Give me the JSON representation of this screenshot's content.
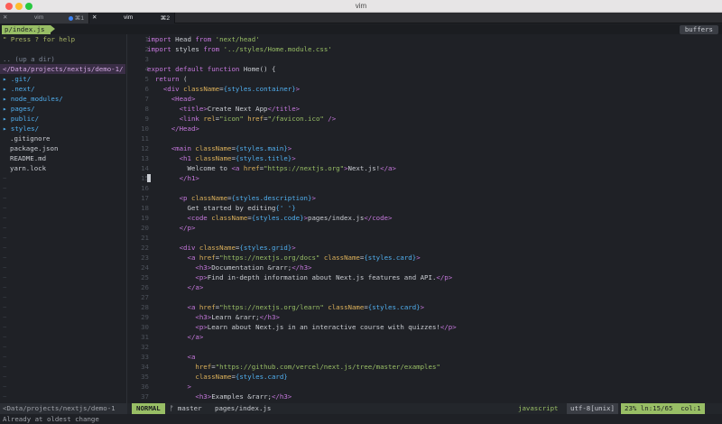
{
  "window": {
    "title": "vim"
  },
  "tabs": [
    {
      "name": "vim",
      "shortcut": "⌘1",
      "close": "✕"
    },
    {
      "name": "vim",
      "shortcut": "⌘2",
      "close": "✕"
    }
  ],
  "tabline": {
    "path": "p/index.js",
    "buffers_label": "buffers"
  },
  "sidebar": {
    "help": "\" Press ? for help",
    "up": ".. (up a dir)",
    "cwd": "</Data/projects/nextjs/demo-1/",
    "dirs": [
      "▸ .git/",
      "▸ .next/",
      "▸ node_modules/",
      "▸ pages/",
      "▸ public/",
      "▸ styles/"
    ],
    "files": [
      ".gitignore",
      "package.json",
      "README.md",
      "yarn.lock"
    ],
    "tilde": "~"
  },
  "editor": {
    "lines": [
      {
        "n": "1",
        "t": "import Head from 'next/head'"
      },
      {
        "n": "2",
        "t": "import styles from '../styles/Home.module.css'"
      },
      {
        "n": "3",
        "t": ""
      },
      {
        "n": "4",
        "t": "export default function Home() {"
      },
      {
        "n": "5",
        "t": "  return ("
      },
      {
        "n": "6",
        "t": "    <div className={styles.container}>"
      },
      {
        "n": "7",
        "t": "      <Head>"
      },
      {
        "n": "8",
        "t": "        <title>Create Next App</title>"
      },
      {
        "n": "9",
        "t": "        <link rel=\"icon\" href=\"/favicon.ico\" />"
      },
      {
        "n": "10",
        "t": "      </Head>"
      },
      {
        "n": "11",
        "t": ""
      },
      {
        "n": "12",
        "t": "      <main className={styles.main}>"
      },
      {
        "n": "13",
        "t": "        <h1 className={styles.title}>"
      },
      {
        "n": "14",
        "t": "          Welcome to <a href=\"https://nextjs.org\">Next.js!</a>"
      },
      {
        "n": "15",
        "t": "        </h1>"
      },
      {
        "n": "16",
        "t": ""
      },
      {
        "n": "17",
        "t": "        <p className={styles.description}>"
      },
      {
        "n": "18",
        "t": "          Get started by editing{' '}"
      },
      {
        "n": "19",
        "t": "          <code className={styles.code}>pages/index.js</code>"
      },
      {
        "n": "20",
        "t": "        </p>"
      },
      {
        "n": "21",
        "t": ""
      },
      {
        "n": "22",
        "t": "        <div className={styles.grid}>"
      },
      {
        "n": "23",
        "t": "          <a href=\"https://nextjs.org/docs\" className={styles.card}>"
      },
      {
        "n": "24",
        "t": "            <h3>Documentation &rarr;</h3>"
      },
      {
        "n": "25",
        "t": "            <p>Find in-depth information about Next.js features and API.</p>"
      },
      {
        "n": "26",
        "t": "          </a>"
      },
      {
        "n": "27",
        "t": ""
      },
      {
        "n": "28",
        "t": "          <a href=\"https://nextjs.org/learn\" className={styles.card}>"
      },
      {
        "n": "29",
        "t": "            <h3>Learn &rarr;</h3>"
      },
      {
        "n": "30",
        "t": "            <p>Learn about Next.js in an interactive course with quizzes!</p>"
      },
      {
        "n": "31",
        "t": "          </a>"
      },
      {
        "n": "32",
        "t": ""
      },
      {
        "n": "33",
        "t": "          <a"
      },
      {
        "n": "34",
        "t": "            href=\"https://github.com/vercel/next.js/tree/master/examples\""
      },
      {
        "n": "35",
        "t": "            className={styles.card}"
      },
      {
        "n": "36",
        "t": "          >"
      },
      {
        "n": "37",
        "t": "            <h3>Examples &rarr;</h3>"
      }
    ],
    "cursor_line": "15"
  },
  "status": {
    "cwd": "<Data/projects/nextjs/demo-1",
    "mode": "NORMAL",
    "branch": "ᚠ master",
    "file": "pages/index.js",
    "filetype": "javascript",
    "encoding": "utf-8[unix]",
    "position": "23% ln:15/65  col:1"
  },
  "cmdline": "Already at oldest change",
  "colors": {
    "accent": "#98be65",
    "directory": "#51afef",
    "keyword": "#c678dd",
    "attribute": "#dcb15a"
  }
}
